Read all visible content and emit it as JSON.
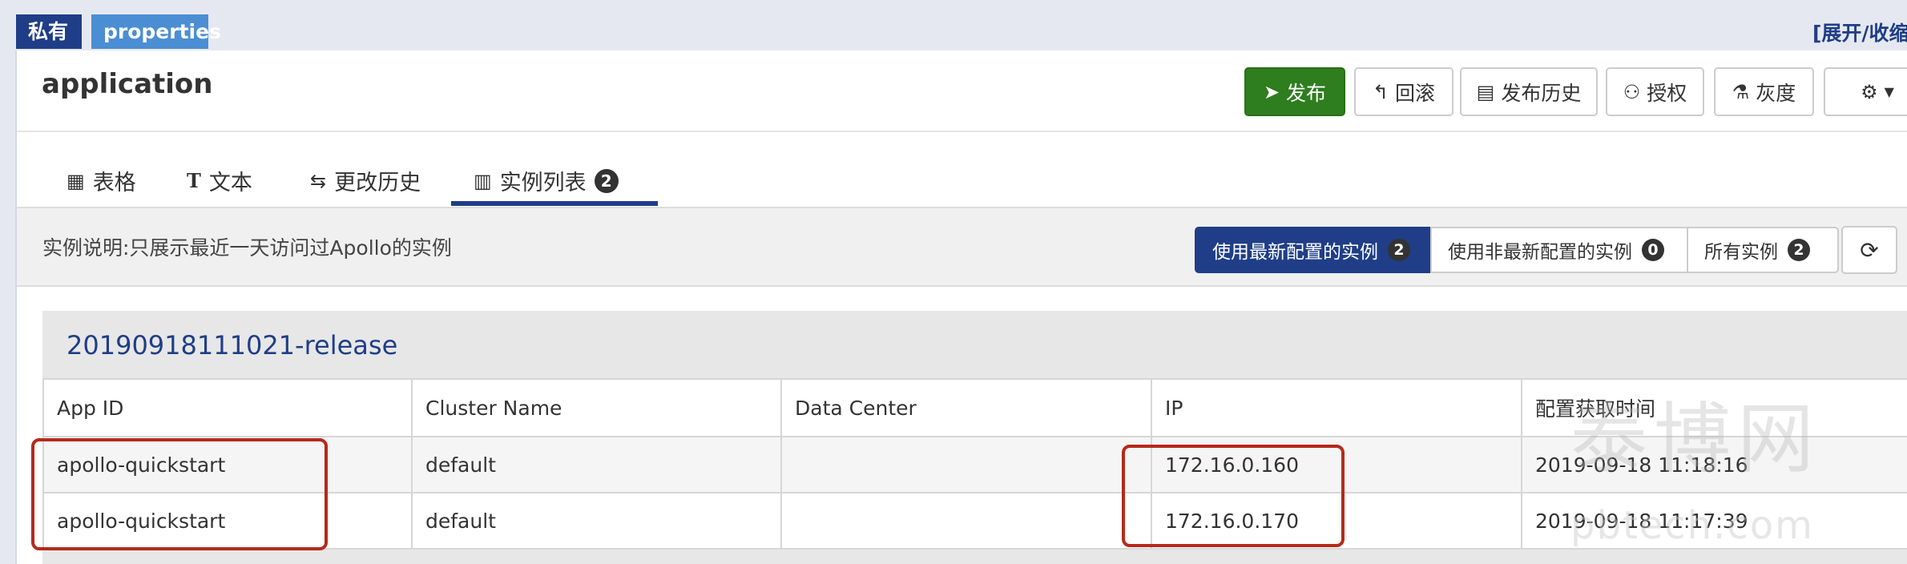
{
  "header": {
    "badge_private": "私有",
    "badge_properties": "properties",
    "expand_link": "[展开/收缩"
  },
  "namespace": {
    "title": "application",
    "actions": {
      "publish": "发布",
      "rollback": "回滚",
      "history": "发布历史",
      "authorize": "授权",
      "gray": "灰度"
    }
  },
  "tabs": [
    {
      "label": "表格",
      "icon": "table-icon"
    },
    {
      "label": "文本",
      "icon": "text-icon"
    },
    {
      "label": "更改历史",
      "icon": "history-icon"
    },
    {
      "label": "实例列表",
      "icon": "instance-list-icon",
      "count": "2",
      "active": true
    }
  ],
  "info": {
    "text": "实例说明:只展示最近一天访问过Apollo的实例",
    "filters": [
      {
        "label": "使用最新配置的实例",
        "count": "2",
        "active": true
      },
      {
        "label": "使用非最新配置的实例",
        "count": "0",
        "active": false
      },
      {
        "label": "所有实例",
        "count": "2",
        "active": false
      }
    ]
  },
  "release": {
    "name": "20190918111021-release",
    "columns": [
      "App ID",
      "Cluster Name",
      "Data Center",
      "IP",
      "配置获取时间"
    ],
    "rows": [
      [
        "apollo-quickstart",
        "default",
        "",
        "172.16.0.160",
        "2019-09-18 11:18:16"
      ],
      [
        "apollo-quickstart",
        "default",
        "",
        "172.16.0.170",
        "2019-09-18 11:17:39"
      ]
    ]
  },
  "watermark": {
    "big": "泰博网",
    "small": "pbtech.com"
  },
  "colors": {
    "primary": "#1f3e87",
    "publish_green": "#2e7d1e",
    "highlight_red": "#b52a1a"
  }
}
